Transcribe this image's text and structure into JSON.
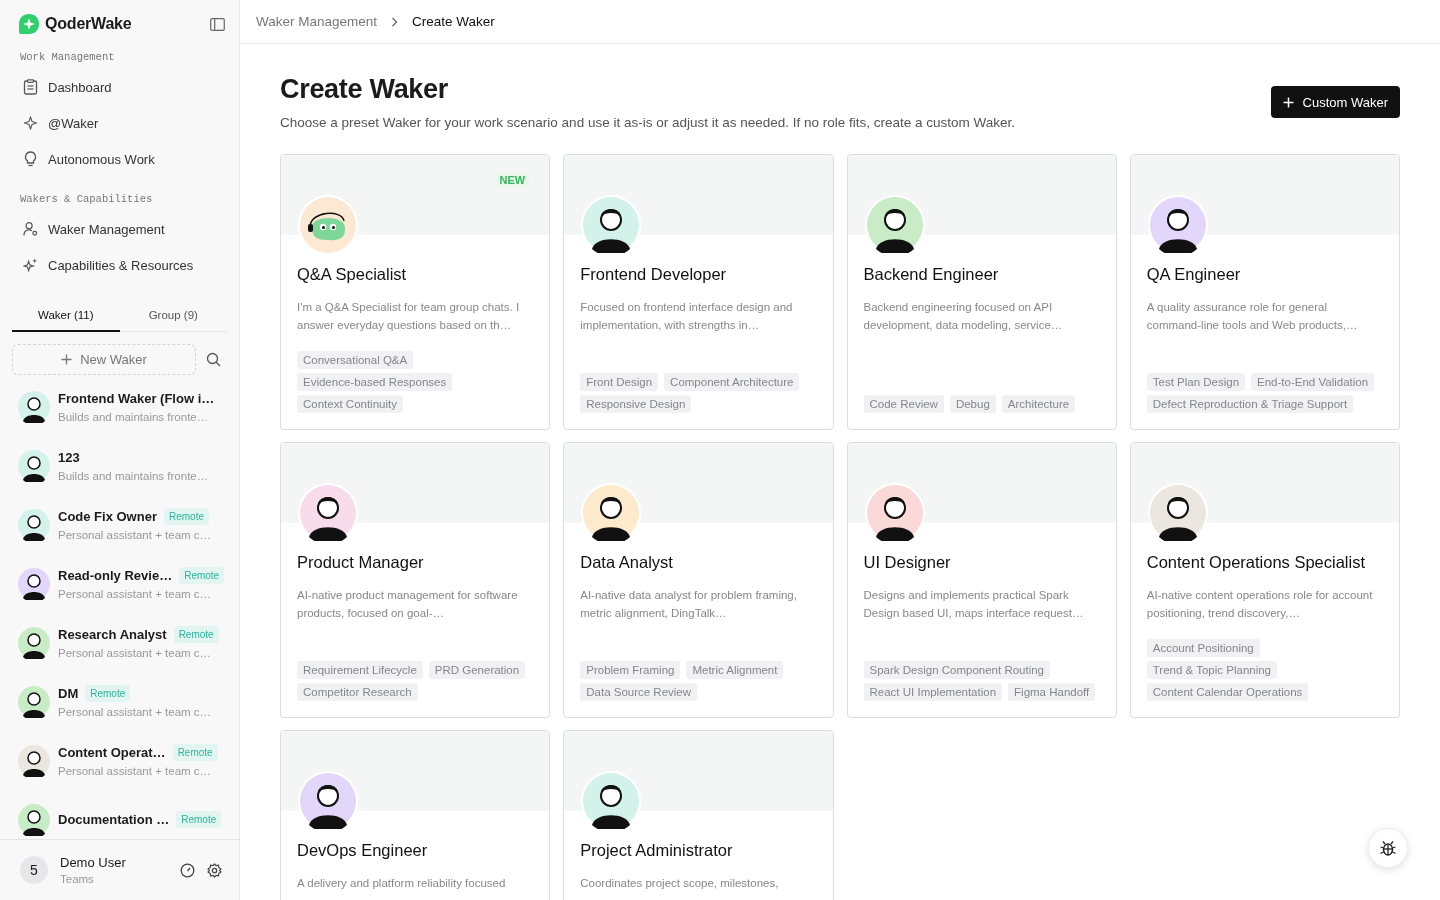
{
  "sidebar": {
    "brand": "QoderWake",
    "sections": [
      {
        "label": "Work Management",
        "items": [
          {
            "label": "Dashboard"
          },
          {
            "label": "@Waker"
          },
          {
            "label": "Autonomous Work"
          }
        ]
      },
      {
        "label": "Wakers & Capabilities",
        "items": [
          {
            "label": "Waker Management"
          },
          {
            "label": "Capabilities & Resources"
          }
        ]
      }
    ],
    "tabs": [
      {
        "label": "Waker (11)",
        "selected": true
      },
      {
        "label": "Group (9)",
        "selected": false
      }
    ],
    "new_button": "New Waker",
    "wakers": [
      {
        "name": "Frontend Waker (Flow i…",
        "subtitle": "Builds and maintains fronte…",
        "color": "#d3f3ea"
      },
      {
        "name": "123",
        "subtitle": "Builds and maintains fronte…",
        "color": "#d3f3ea"
      },
      {
        "name": "Code Fix Owner",
        "badge": "Remote",
        "subtitle": "Personal assistant + team c…",
        "color": "#d3f3ea"
      },
      {
        "name": "Read-only Revie…",
        "badge": "Remote",
        "subtitle": "Personal assistant + team c…",
        "color": "#e2d6fb"
      },
      {
        "name": "Research Analyst",
        "badge": "Remote",
        "subtitle": "Personal assistant + team c…",
        "color": "#c8ecc6"
      },
      {
        "name": "DM",
        "badge": "Remote",
        "subtitle": "Personal assistant + team c…",
        "color": "#c8ecc6"
      },
      {
        "name": "Content Operat…",
        "badge": "Remote",
        "subtitle": "Personal assistant + team c…",
        "color": "#ebe6df"
      },
      {
        "name": "Documentation …",
        "badge": "Remote",
        "color": "#c8ecc6"
      }
    ],
    "user": {
      "initial": "5",
      "name": "Demo User",
      "org": "Teams"
    }
  },
  "breadcrumb": [
    {
      "label": "Waker Management",
      "selected": false
    },
    {
      "label": "Create Waker",
      "selected": true
    }
  ],
  "page": {
    "title": "Create Waker",
    "subtitle": "Choose a preset Waker for your work scenario and use it as-is or adjust it as needed. If no role fits, create a custom Waker.",
    "button": "Custom Waker"
  },
  "cards": [
    {
      "title": "Q&A Specialist",
      "kind": "mascot",
      "color": "#fde8d4",
      "badge": "NEW",
      "description": "I'm a Q&A Specialist for team group chats. I answer everyday questions based on th…",
      "tags": [
        "Conversational Q&A",
        "Evidence-based Responses",
        "Context Continuity"
      ]
    },
    {
      "title": "Frontend Developer",
      "kind": "person",
      "color": "#d3f3ea",
      "description": "Focused on frontend interface design and implementation, with strengths in…",
      "tags": [
        "Front Design",
        "Component Architecture",
        "Responsive Design"
      ]
    },
    {
      "title": "Backend Engineer",
      "kind": "person",
      "color": "#c8ecc6",
      "description": "Backend engineering focused on API development, data modeling, service…",
      "tags": [
        "Code Review",
        "Debug",
        "Architecture"
      ]
    },
    {
      "title": "QA Engineer",
      "kind": "person",
      "color": "#e2d6fb",
      "description": "A quality assurance role for general command-line tools and Web products,…",
      "tags": [
        "Test Plan Design",
        "End-to-End Validation",
        "Defect Reproduction & Triage Support"
      ]
    },
    {
      "title": "Product Manager",
      "kind": "person",
      "color": "#f9dcec",
      "description": "AI-native product management for software products, focused on goal-…",
      "tags": [
        "Requirement Lifecycle",
        "PRD Generation",
        "Competitor Research"
      ]
    },
    {
      "title": "Data Analyst",
      "kind": "person",
      "color": "#fde9cc",
      "description": "AI-native data analyst for problem framing, metric alignment, DingTalk…",
      "tags": [
        "Problem Framing",
        "Metric Alignment",
        "Data Source Review"
      ]
    },
    {
      "title": "UI Designer",
      "kind": "person",
      "color": "#fcd9d9",
      "description": "Designs and implements practical Spark Design based UI, maps interface request…",
      "tags": [
        "Spark Design Component Routing",
        "React UI Implementation",
        "Figma Handoff"
      ]
    },
    {
      "title": "Content Operations Specialist",
      "kind": "person",
      "color": "#ebe6df",
      "description": "AI-native content operations role for account positioning, trend discovery,…",
      "tags": [
        "Account Positioning",
        "Trend & Topic Planning",
        "Content Calendar Operations"
      ]
    },
    {
      "title": "DevOps Engineer",
      "kind": "person",
      "color": "#e2d6fb",
      "description": "A delivery and platform reliability focused"
    },
    {
      "title": "Project Administrator",
      "kind": "person",
      "color": "#d3f3ea",
      "description": "Coordinates project scope, milestones,"
    }
  ]
}
